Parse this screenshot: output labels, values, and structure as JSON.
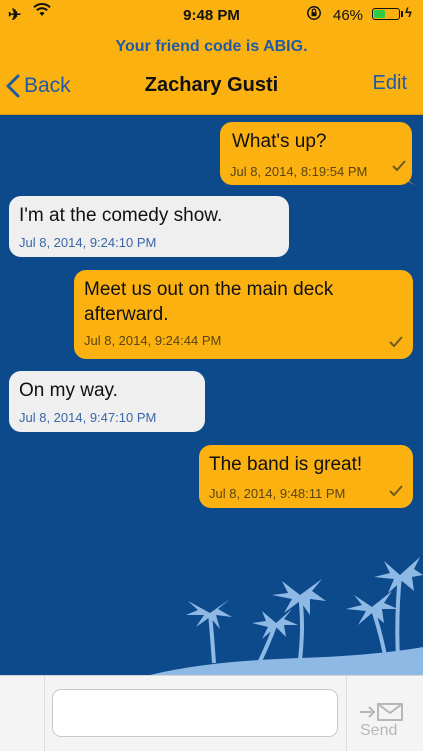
{
  "status": {
    "time": "9:48 PM",
    "battery_pct_label": "46%",
    "battery_level": 0.46,
    "airplane_icon": "airplane-icon",
    "wifi_icon": "wifi-icon",
    "lock_icon": "orientation-lock-icon",
    "charging_icon": "lightning-bolt-icon"
  },
  "header": {
    "friend_code_text": "Your friend code is ABIG.",
    "back_label": "Back",
    "title": "Zachary Gusti",
    "edit_label": "Edit"
  },
  "messages": [
    {
      "direction": "outgoing",
      "text": "What's up?",
      "timestamp": "Jul 8, 2014, 8:19:54 PM",
      "delivered": true
    },
    {
      "direction": "incoming",
      "text": "I'm at the comedy show.",
      "timestamp": "Jul 8, 2014, 9:24:10 PM"
    },
    {
      "direction": "outgoing",
      "text_line1": "Meet us out on the main deck",
      "text_line2": "afterward.",
      "timestamp": "Jul 8, 2014, 9:24:44 PM",
      "delivered": true
    },
    {
      "direction": "incoming",
      "text": "On my way.",
      "timestamp": "Jul 8, 2014, 9:47:10 PM"
    },
    {
      "direction": "outgoing",
      "text": "The band is great!",
      "timestamp": "Jul 8, 2014, 9:48:11 PM",
      "delivered": true
    }
  ],
  "composer": {
    "input_value": "",
    "send_label": "Send",
    "send_icon": "send-envelope-icon"
  },
  "colors": {
    "accent": "#fbb210",
    "background": "#0d4a8c",
    "link": "#1f5aa8",
    "incoming_bubble": "#efefef",
    "island": "#8eb9e4"
  }
}
